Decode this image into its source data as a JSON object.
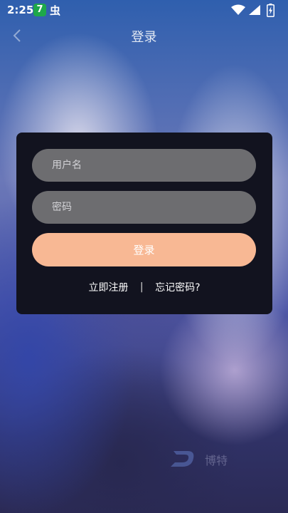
{
  "status_bar": {
    "time": "2:25",
    "app_badge": "7",
    "bug_glyph": "虫",
    "icons": [
      "wifi-icon",
      "signal-icon",
      "battery-icon"
    ]
  },
  "nav": {
    "title": "登录",
    "back_icon": "chevron-left-icon"
  },
  "form": {
    "username_placeholder": "用户名",
    "password_placeholder": "密码",
    "login_label": "登录"
  },
  "links": {
    "register": "立即注册",
    "divider": "|",
    "forgot": "忘记密码?"
  },
  "watermark": {
    "text": "博特"
  },
  "colors": {
    "card_bg": "#12131f",
    "input_bg": "#6d6d70",
    "button_bg": "#f8b894"
  }
}
